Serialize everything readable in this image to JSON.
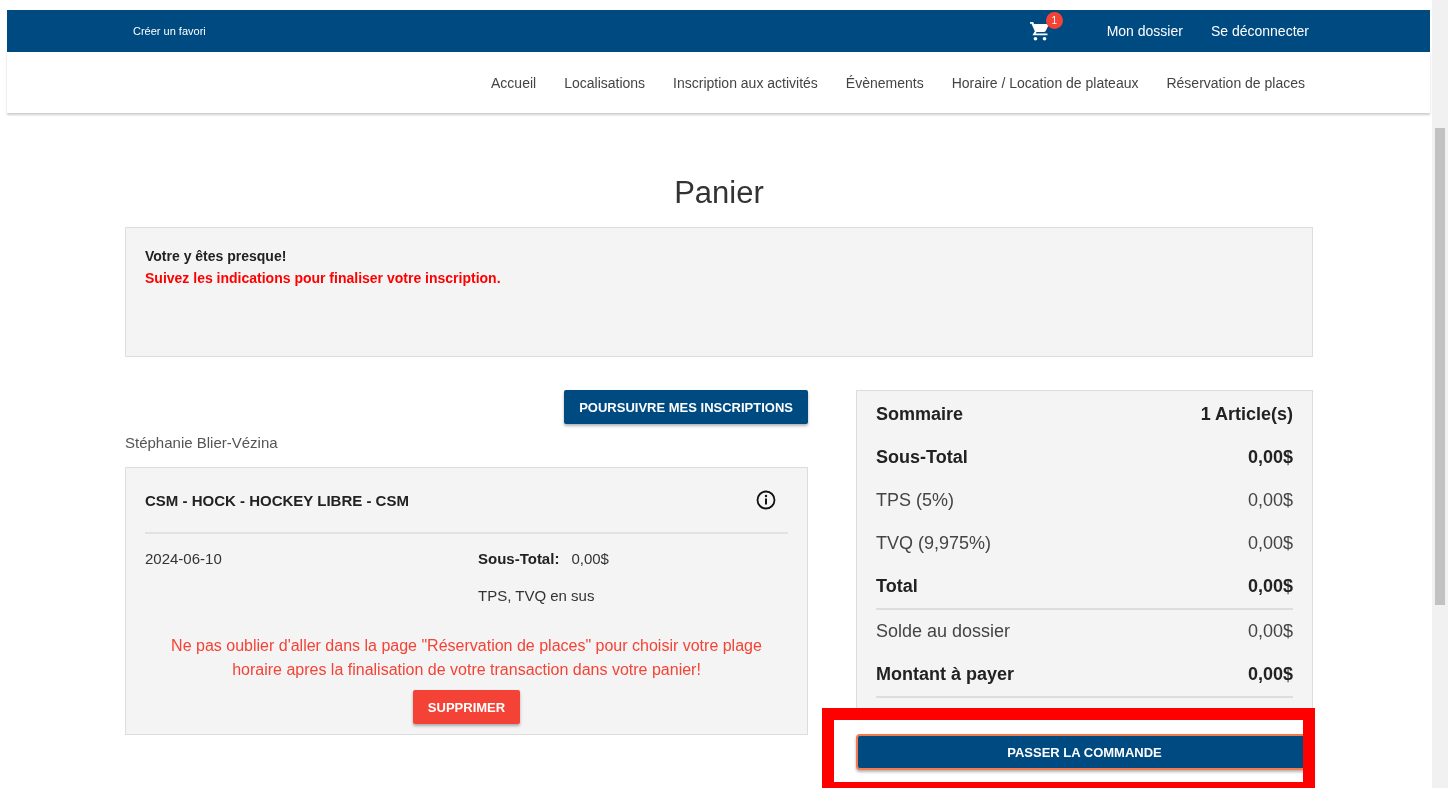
{
  "top_bar": {
    "favorite_link": "Créer un favori",
    "cart_count": "1",
    "links": [
      "Mon dossier",
      "Se déconnecter"
    ]
  },
  "nav": {
    "items": [
      "Accueil",
      "Localisations",
      "Inscription aux activités",
      "Évènements",
      "Horaire / Location de plateaux",
      "Réservation de places"
    ]
  },
  "page_title": "Panier",
  "notice": {
    "title": "Votre y êtes presque!",
    "message": "Suivez les indications pour finaliser votre inscription."
  },
  "continue_button": "POURSUIVRE MES INSCRIPTIONS",
  "participant": "Stéphanie Blier-Vézina",
  "cart_item": {
    "title": "CSM - HOCK - HOCKEY LIBRE - CSM",
    "date": "2024-06-10",
    "subtotal_label": "Sous-Total:",
    "subtotal": "0,00$",
    "tax_note": "TPS, TVQ en sus",
    "reminder": "Ne pas oublier d'aller dans la page \"Réservation de places\" pour choisir votre plage horaire apres la finalisation de votre transaction dans votre panier!",
    "delete_button": "SUPPRIMER"
  },
  "summary": {
    "rows": [
      {
        "label": "Sommaire",
        "value": "1 Article(s)",
        "bold": true,
        "divider": false
      },
      {
        "label": "Sous-Total",
        "value": "0,00$",
        "bold": true,
        "divider": false
      },
      {
        "label": "TPS (5%)",
        "value": "0,00$",
        "bold": false,
        "divider": false
      },
      {
        "label": "TVQ (9,975%)",
        "value": "0,00$",
        "bold": false,
        "divider": false
      },
      {
        "label": "Total",
        "value": "0,00$",
        "bold": true,
        "divider": true
      },
      {
        "label": "Solde au dossier",
        "value": "0,00$",
        "bold": false,
        "divider": false
      },
      {
        "label": "Montant à payer",
        "value": "0,00$",
        "bold": true,
        "divider": true
      }
    ],
    "order_button": "PASSER LA COMMANDE",
    "order_button_highlighted": true
  }
}
